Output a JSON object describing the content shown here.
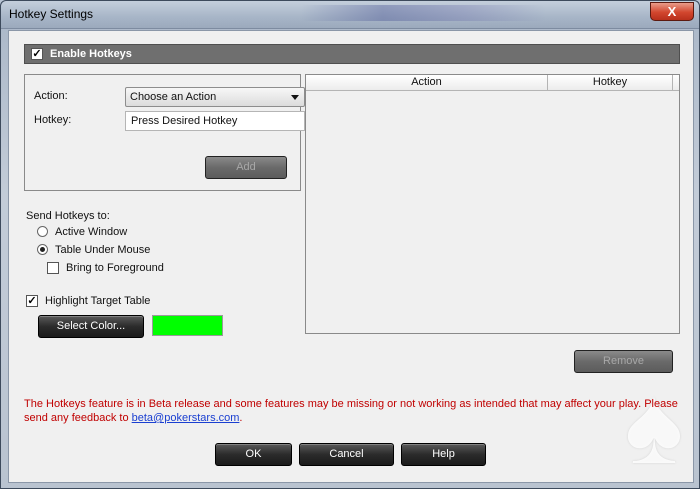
{
  "window": {
    "title": "Hotkey Settings",
    "close_glyph": "X"
  },
  "enable_hotkeys": {
    "label": "Enable Hotkeys",
    "checked": true
  },
  "form": {
    "action_label": "Action:",
    "action_value": "Choose an Action",
    "hotkey_label": "Hotkey:",
    "hotkey_value": "Press Desired Hotkey",
    "add_label": "Add"
  },
  "list": {
    "columns": [
      "Action",
      "Hotkey"
    ],
    "remove_label": "Remove"
  },
  "send": {
    "heading": "Send Hotkeys to:",
    "options": [
      {
        "label": "Active Window",
        "selected": false
      },
      {
        "label": "Table Under Mouse",
        "selected": true
      }
    ],
    "bring_to_foreground": {
      "label": "Bring to Foreground",
      "checked": false
    }
  },
  "highlight": {
    "label": "Highlight Target Table",
    "checked": true,
    "select_color_label": "Select Color...",
    "color": "#00ff00"
  },
  "notice": {
    "text": "The Hotkeys feature is in Beta release and some features may be missing or not working as intended that may affect your play. Please send any feedback to ",
    "link": "beta@pokerstars.com",
    "suffix": "."
  },
  "buttons": {
    "ok": "OK",
    "cancel": "Cancel",
    "help": "Help"
  },
  "logo_glyph": "♠",
  "icons": {
    "checkbox": "checkmark-icon",
    "dropdown": "chevron-down-icon",
    "logo": "pokerstars-spade-logo"
  }
}
